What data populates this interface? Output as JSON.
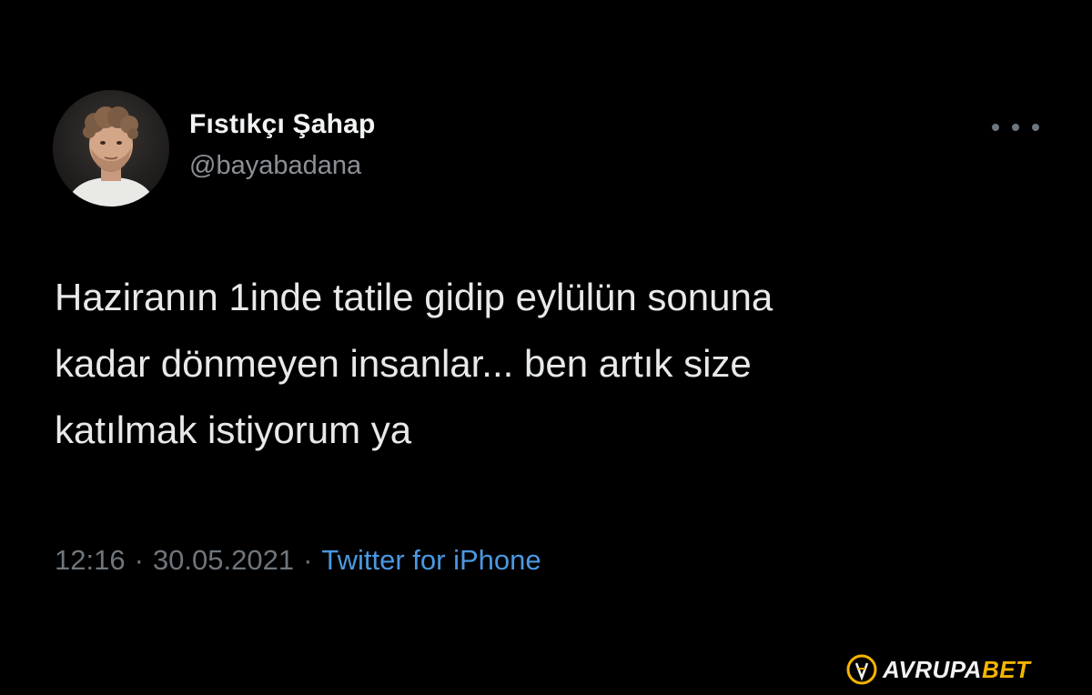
{
  "tweet": {
    "author": {
      "display_name": "Fıstıkçı Şahap",
      "handle": "@bayabadana",
      "avatar_icon": "profile-photo"
    },
    "more_icon": "more-horizontal-icon",
    "text": "Haziranın 1inde tatile gidip eylülün sonuna\nkadar dönmeyen insanlar... ben artık size\nkatılmak istiyorum ya",
    "time": "12:16",
    "separator": "·",
    "date": "30.05.2021",
    "source": "Twitter for iPhone"
  },
  "watermark": {
    "part1": "AVRUPA",
    "part2": "BET",
    "logo_icon": "avrupabet-logo",
    "colors": {
      "part1": "#f2f2f2",
      "part2": "#f4b400"
    }
  },
  "colors": {
    "background": "#000000",
    "text": "#e7e9ea",
    "secondary": "#6e767d",
    "link": "#4a98e0"
  }
}
